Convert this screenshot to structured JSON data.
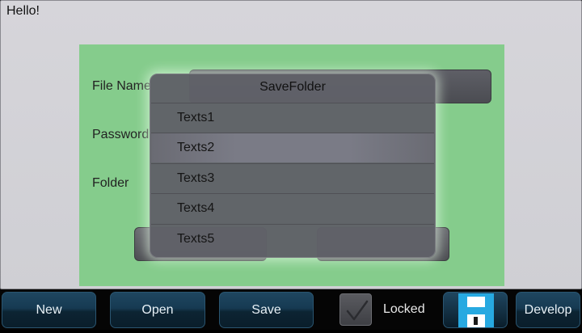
{
  "window": {
    "greeting": "Hello!"
  },
  "form": {
    "file_name_label": "File Name",
    "password_label": "Password",
    "folder_label": "Folder"
  },
  "dialog": {
    "title": "SaveFolder",
    "items": [
      "Texts1",
      "Texts2",
      "Texts3",
      "Texts4",
      "Texts5"
    ],
    "selected_index": 1
  },
  "toolbar": {
    "new_label": "New",
    "open_label": "Open",
    "save_label": "Save",
    "locked_label": "Locked",
    "locked_checked": true,
    "save_icon": "floppy-disk-icon",
    "develop_label": "Develop"
  },
  "colors": {
    "panel": "#85cc8c",
    "toolbar_button": "#163a52",
    "floppy": "#27a9e1"
  }
}
